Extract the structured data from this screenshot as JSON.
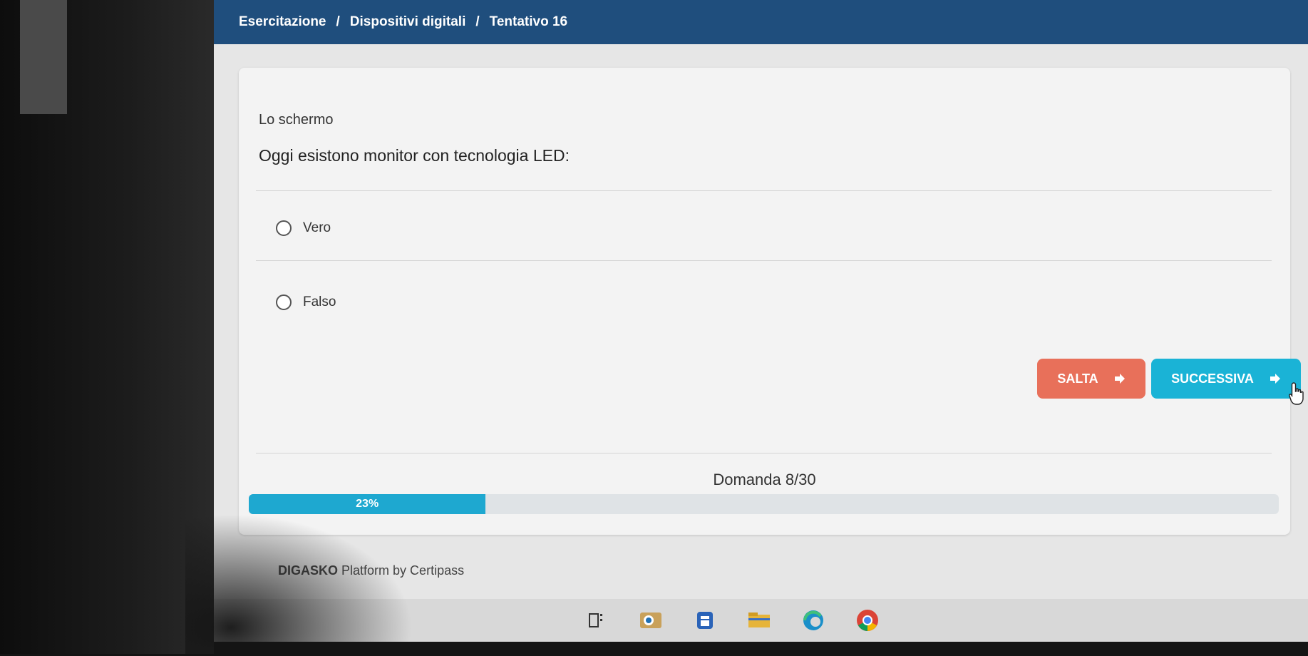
{
  "breadcrumb": {
    "items": [
      "Esercitazione",
      "Dispositivi digitali",
      "Tentativo 16"
    ],
    "separator": "/"
  },
  "quiz": {
    "subject": "Lo schermo",
    "question": "Oggi esistono monitor con tecnologia LED:",
    "options": [
      {
        "label": "Vero",
        "selected": false
      },
      {
        "label": "Falso",
        "selected": false
      }
    ],
    "skip_label": "SALTA",
    "next_label": "SUCCESSIVA",
    "counter": "Domanda 8/30",
    "progress_label": "23%",
    "progress_value": 23
  },
  "footer": {
    "brand": "DIGASKO",
    "text": "Platform by Certipass"
  },
  "colors": {
    "topbar": "#1f4e7d",
    "skip": "#e8705a",
    "next": "#1ab3d6",
    "progress": "#1ea8d0"
  },
  "taskbar": {
    "icons": [
      "task-view-icon",
      "outlook-icon",
      "calendar-icon",
      "file-explorer-icon",
      "edge-icon",
      "chrome-icon"
    ]
  }
}
